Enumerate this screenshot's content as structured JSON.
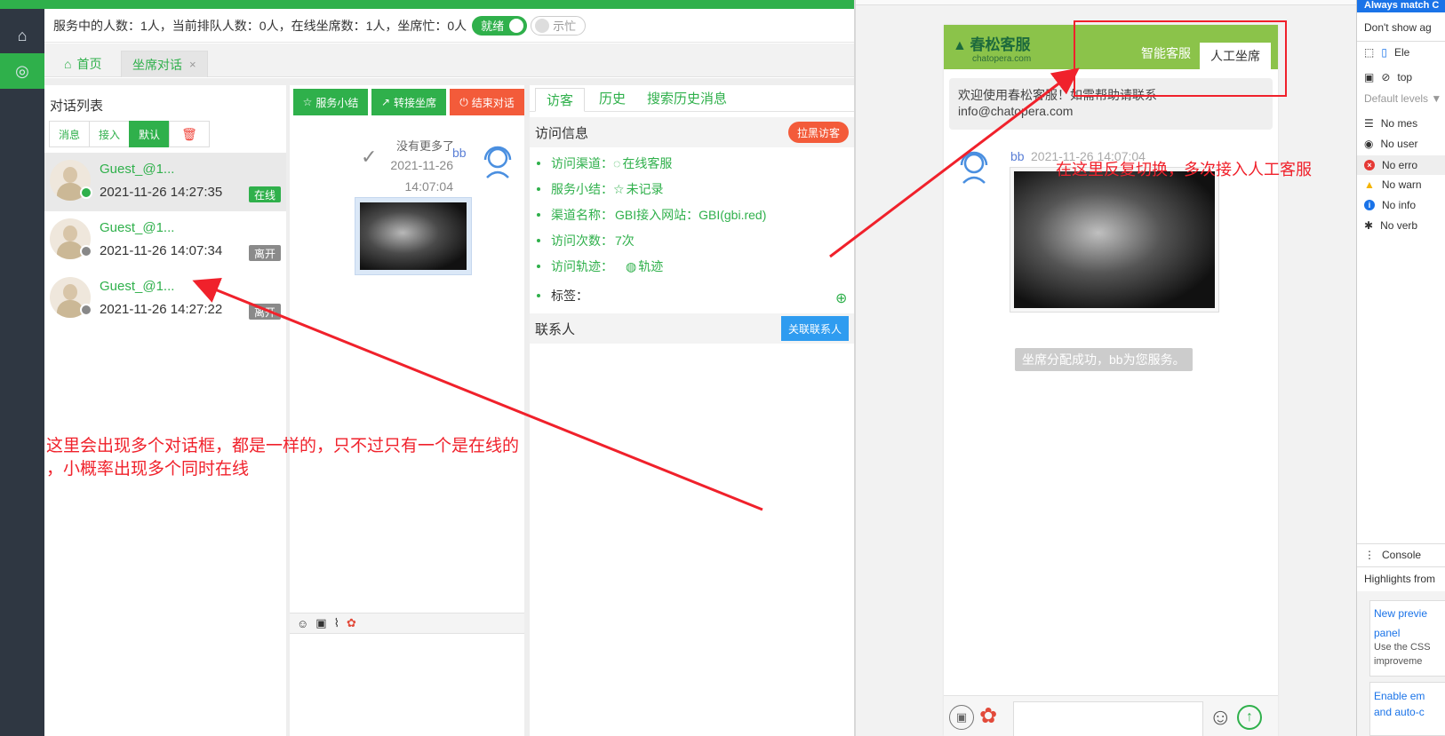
{
  "status": {
    "text": "服务中的人数：1人，当前排队人数：0人，在线坐席数：1人，坐席忙：0人",
    "ready_label": "就绪",
    "busy_label": "示忙"
  },
  "tabs": [
    {
      "label": "首页"
    },
    {
      "label": "坐席对话",
      "close": "×"
    }
  ],
  "conversation_list": {
    "title": "对话列表",
    "filters": [
      "消息",
      "接入",
      "默认"
    ],
    "items": [
      {
        "name": "Guest_@1...",
        "time": "2021-11-26 14:27:35",
        "status": "在线",
        "status_color": "#2fb04b"
      },
      {
        "name": "Guest_@1...",
        "time": "2021-11-26 14:07:34",
        "status": "离开",
        "status_color": "#8a8a8a"
      },
      {
        "name": "Guest_@1...",
        "time": "2021-11-26 14:27:22",
        "status": "离开",
        "status_color": "#8a8a8a"
      }
    ]
  },
  "chat": {
    "actions": [
      {
        "label": "服务小结",
        "icon": "☆"
      },
      {
        "label": "转接坐席",
        "icon": "↗"
      },
      {
        "label": "结束对话",
        "icon": "⏻"
      }
    ],
    "no_more": "没有更多了",
    "sender": "bb",
    "date": "2021-11-26",
    "time": "14:07:04"
  },
  "visitor": {
    "tabs": [
      "访客",
      "历史",
      "搜索历史消息"
    ],
    "info_title": "访问信息",
    "blacklist_button": "拉黑访客",
    "fields": [
      {
        "label": "访问渠道：",
        "value": "在线客服"
      },
      {
        "label": "服务小结：",
        "value": "未记录"
      },
      {
        "label": "渠道名称：",
        "value": "GBI接入网站：GBI(gbi.red)"
      },
      {
        "label": "访问次数：",
        "value": "7次"
      },
      {
        "label": "访问轨迹：",
        "value": "轨迹"
      },
      {
        "label": "标签：",
        "value": ""
      }
    ],
    "contacts_title": "联系人",
    "link_contact_button": "关联联系人"
  },
  "widget": {
    "brand": "春松客服",
    "brand_sub": "chatopera.com",
    "tabs": [
      "智能客服",
      "人工坐席"
    ],
    "welcome_line1": "欢迎使用春松客服！如需帮助请联系",
    "welcome_line2": "info@chatopera.com",
    "sender": "bb",
    "time": "2021-11-26 14:07:04",
    "system_msg": "坐席分配成功，bb为您服务。"
  },
  "devtools": {
    "top_label": "Always match C",
    "dont_show": "Don't show ag",
    "tab_label": "Ele",
    "context": "top",
    "levels": "Default levels ▼",
    "filters": [
      {
        "label": "No mes",
        "icon": "list-icon"
      },
      {
        "label": "No user",
        "icon": "user-icon"
      },
      {
        "label": "No erro",
        "icon": "error-icon"
      },
      {
        "label": "No warn",
        "icon": "warning-icon"
      },
      {
        "label": "No info",
        "icon": "info-icon"
      },
      {
        "label": "No verb",
        "icon": "bug-icon"
      }
    ],
    "console_tab": "Console",
    "highlights": "Highlights from",
    "link1": "New previe",
    "link1b": "panel",
    "desc1": "Use the CSS",
    "desc2": "improveme",
    "link2": "Enable em",
    "link2b": "and auto-c"
  },
  "annotations": {
    "left_line1": "这里会出现多个对话框，都是一样的，只不过只有一个是在线的",
    "left_line2": "，小概率出现多个同时在线",
    "right": "在这里反复切换，多次接入人工客服"
  }
}
